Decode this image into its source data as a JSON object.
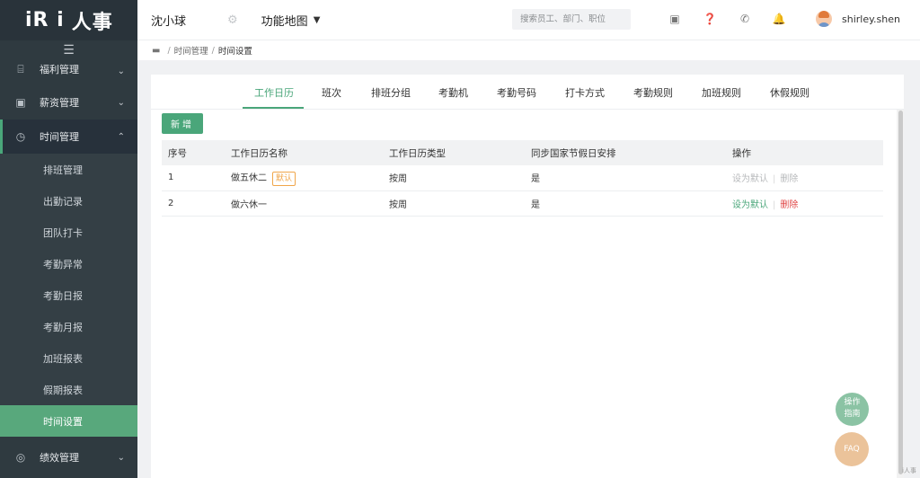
{
  "app": {
    "logo_text": "人事",
    "logo_mark": "iR i"
  },
  "sidebar": {
    "menu_icon": "hamburger-icon",
    "groups": [
      {
        "label": "福利管理",
        "icon": "gift-icon"
      },
      {
        "label": "薪资管理",
        "icon": "wallet-icon"
      },
      {
        "label": "时间管理",
        "icon": "clock-icon",
        "open": true
      },
      {
        "label": "绩效管理",
        "icon": "target-icon"
      }
    ],
    "time_items": [
      "排班管理",
      "出勤记录",
      "团队打卡",
      "考勤异常",
      "考勤日报",
      "考勤月报",
      "加班报表",
      "假期报表",
      "时间设置"
    ],
    "active_item": "时间设置"
  },
  "header": {
    "company": "沈小球",
    "func_map": "功能地图",
    "search_placeholder": "搜索员工、部门、职位",
    "username": "shirley.shen"
  },
  "breadcrumb": {
    "level1": "时间管理",
    "level2": "时间设置"
  },
  "tabs": [
    "工作日历",
    "班次",
    "排班分组",
    "考勤机",
    "考勤号码",
    "打卡方式",
    "考勤规则",
    "加班规则",
    "休假规则"
  ],
  "active_tab": "工作日历",
  "toolbar": {
    "add_label": "新增"
  },
  "table": {
    "headers": [
      "序号",
      "工作日历名称",
      "工作日历类型",
      "同步国家节假日安排",
      "操作"
    ],
    "rows": [
      {
        "no": "1",
        "name": "做五休二",
        "badge": "默认",
        "type": "按周",
        "sync": "是",
        "set_default": "设为默认",
        "delete": "删除"
      },
      {
        "no": "2",
        "name": "做六休一",
        "type": "按周",
        "sync": "是",
        "set_default": "设为默认",
        "delete": "删除"
      }
    ]
  },
  "float": {
    "guide_line1": "操作",
    "guide_line2": "指南",
    "faq": "FAQ"
  },
  "footer_mark": "i人事",
  "colors": {
    "accent": "#4aa67a",
    "sidebar_bg": "#2f3a40",
    "danger": "#e04545",
    "badge": "#f0a64a"
  }
}
